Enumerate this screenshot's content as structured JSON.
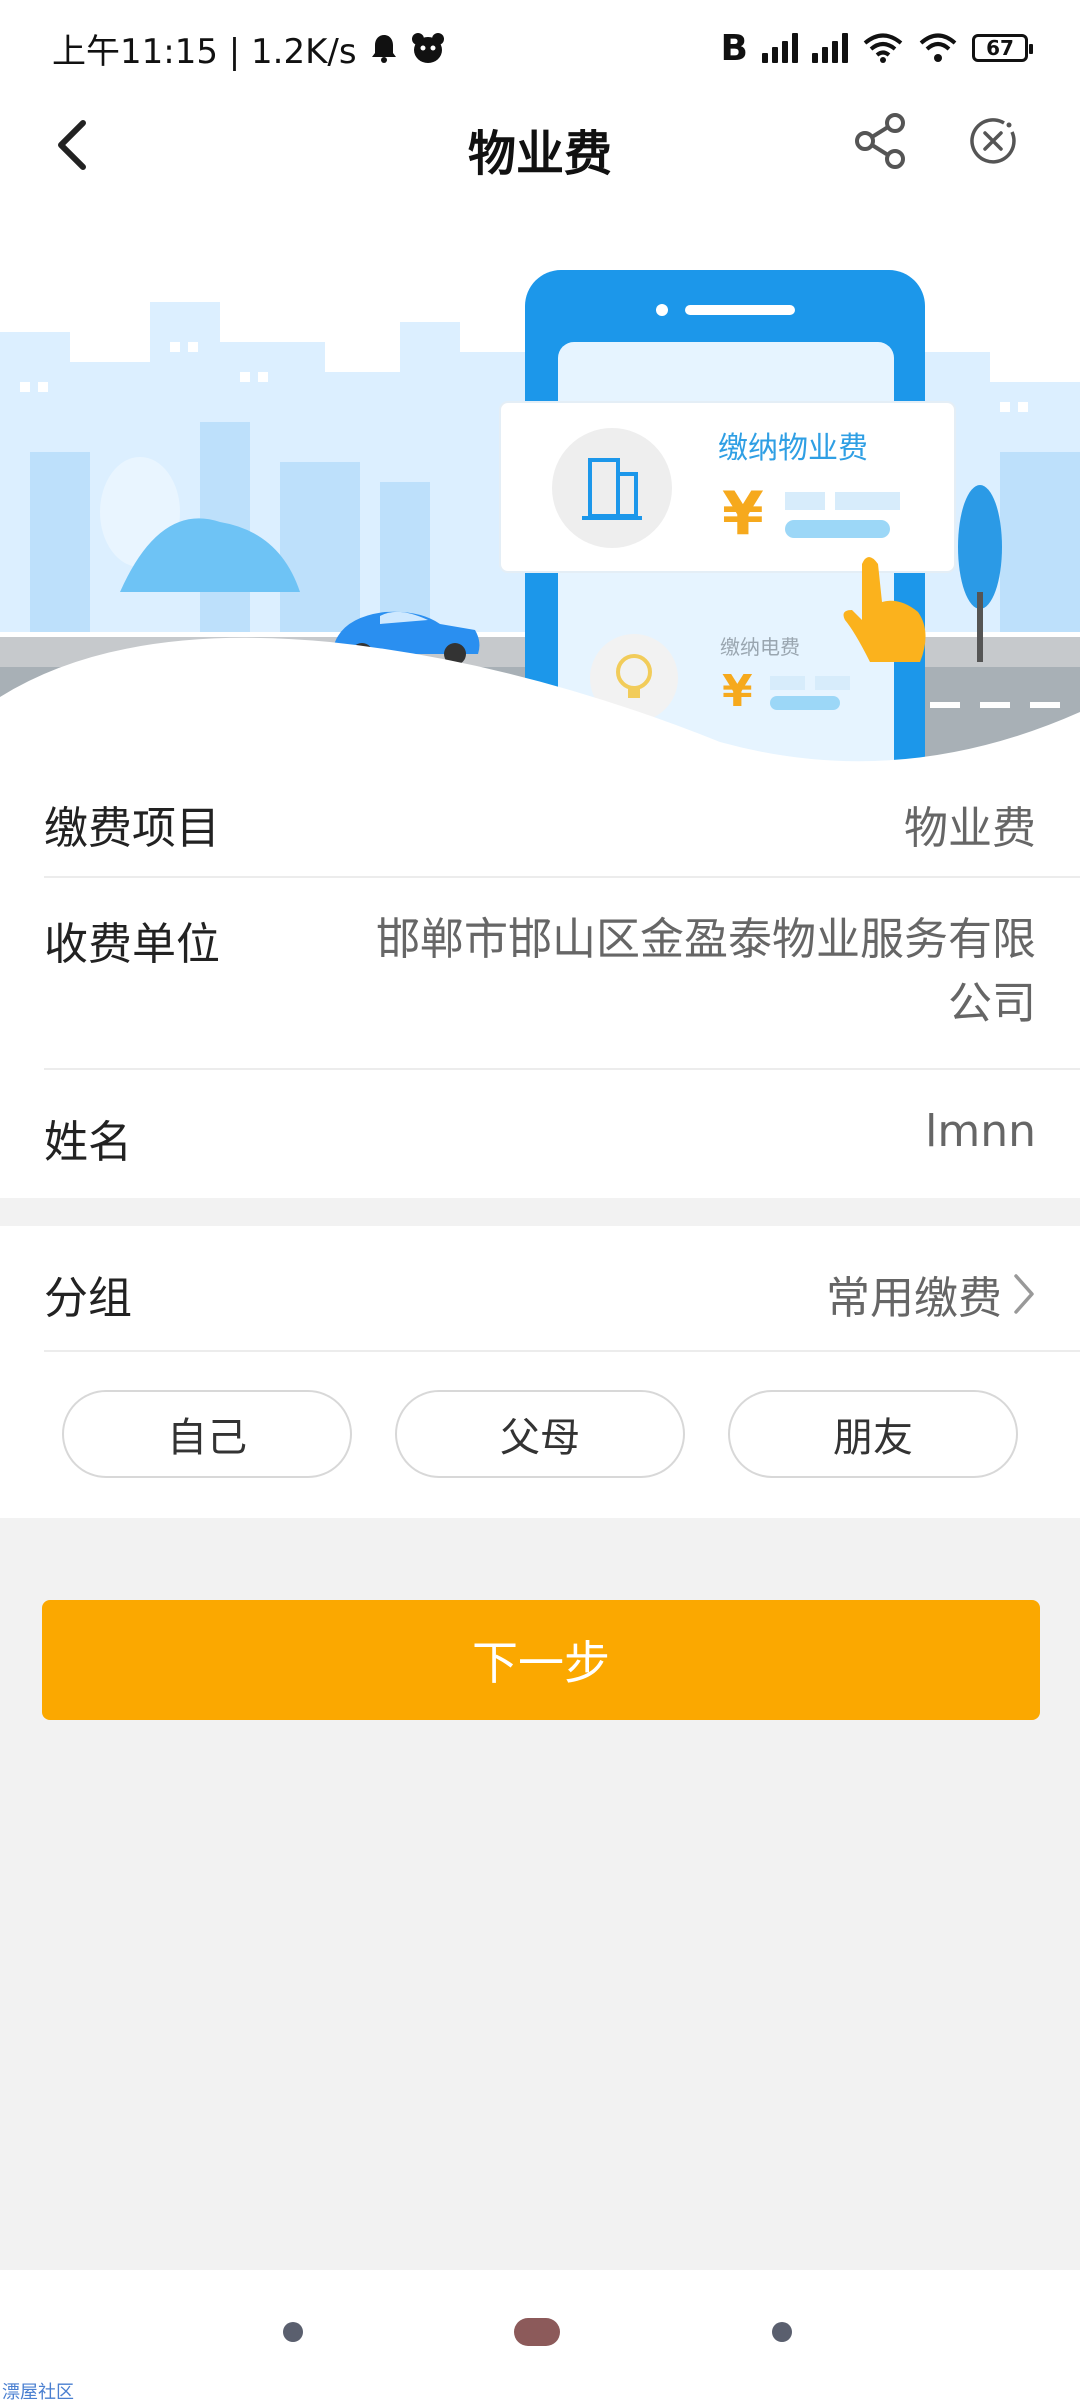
{
  "status_bar": {
    "time_text": "上午11:15 | 1.2K/s",
    "bluetooth": "B",
    "battery": "67"
  },
  "header": {
    "title": "物业费"
  },
  "banner": {
    "card_main_label": "缴纳物业费",
    "card_main_symbol": "¥",
    "card_sub_label": "缴纳电费",
    "card_sub_symbol": "¥"
  },
  "form": {
    "item_label": "缴费项目",
    "item_value": "物业费",
    "unit_label": "收费单位",
    "unit_value": "邯郸市邯山区金盈泰物业服务有限公司",
    "name_label": "姓名",
    "name_value": "lmnn"
  },
  "group": {
    "label": "分组",
    "value": "常用缴费",
    "chips": [
      "自己",
      "父母",
      "朋友"
    ]
  },
  "actions": {
    "next_label": "下一步"
  },
  "footer": {
    "watermark": "漂屋社区"
  },
  "colors": {
    "accent": "#fba800",
    "banner_blue": "#1c97ea",
    "page_bg": "#f2f2f2"
  }
}
